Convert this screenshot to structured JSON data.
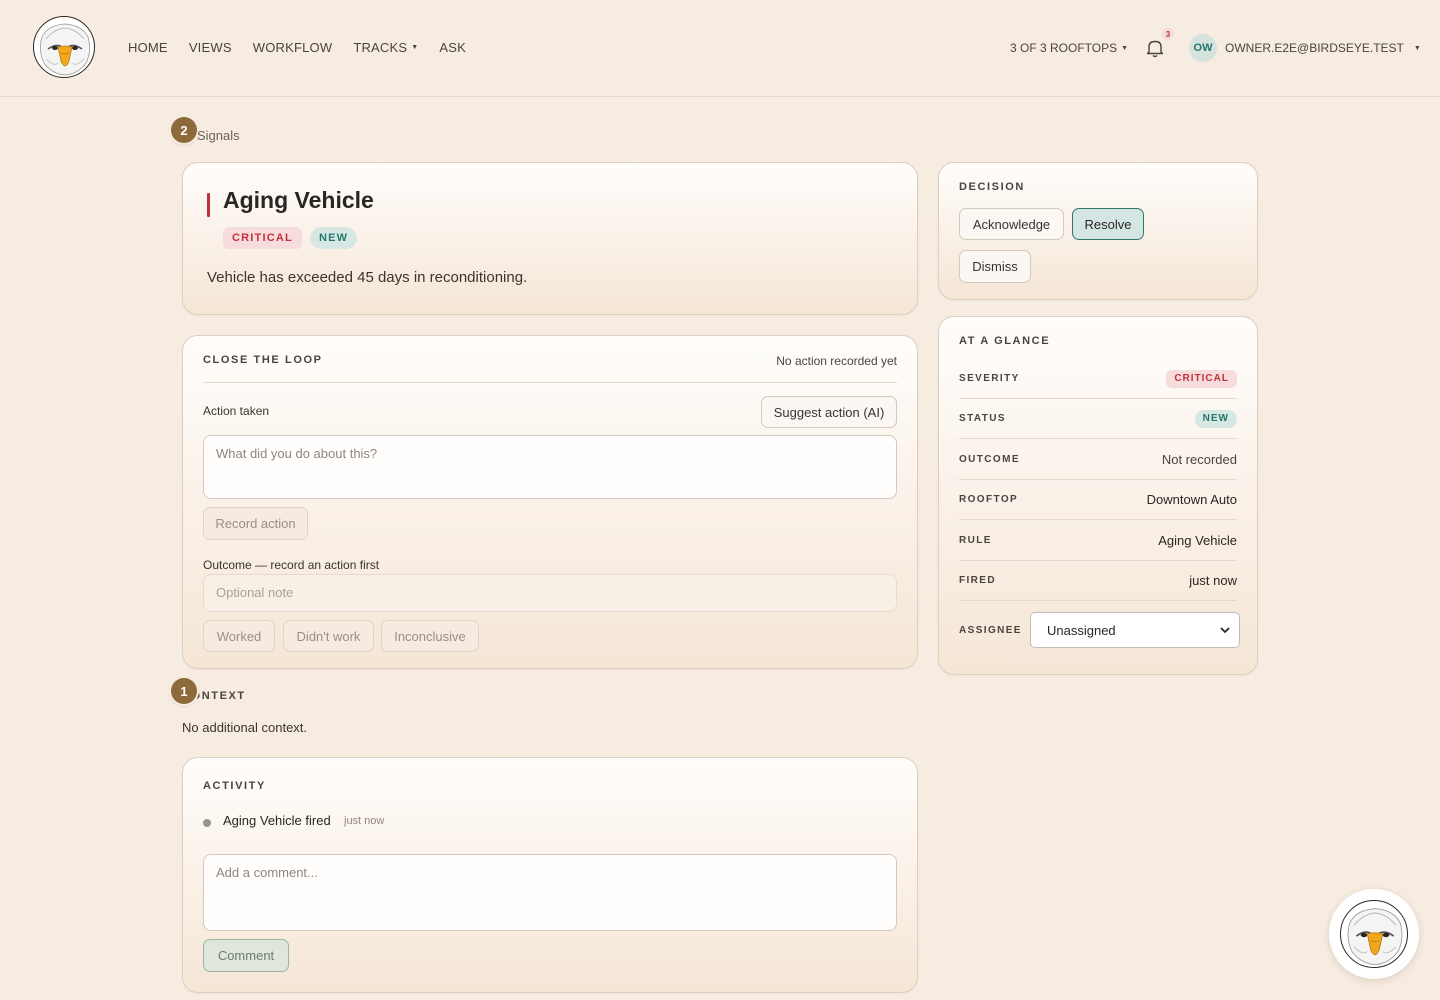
{
  "nav": {
    "items": [
      {
        "label": "HOME"
      },
      {
        "label": "VIEWS"
      },
      {
        "label": "WORKFLOW"
      },
      {
        "label": "TRACKS",
        "has_dropdown": true
      },
      {
        "label": "ASK"
      }
    ],
    "rooftops_label": "3 OF 3 ROOFTOPS",
    "notification_count": "3",
    "avatar_initials": "OW",
    "user_email": "OWNER.E2E@BIRDSEYE.TEST"
  },
  "markers": {
    "first": "2",
    "second": "1"
  },
  "breadcrumb": "Signals",
  "signal": {
    "title": "Aging Vehicle",
    "severity_badge": "CRITICAL",
    "status_badge": "NEW",
    "description": "Vehicle has exceeded 45 days in reconditioning."
  },
  "close_loop": {
    "title": "CLOSE THE LOOP",
    "status": "No action recorded yet",
    "action_label": "Action taken",
    "suggest_button": "Suggest action (AI)",
    "action_placeholder": "What did you do about this?",
    "record_button": "Record action",
    "outcome_label": "Outcome — record an action first",
    "note_placeholder": "Optional note",
    "outcome_buttons": [
      "Worked",
      "Didn't work",
      "Inconclusive"
    ]
  },
  "context": {
    "title": "CONTEXT",
    "text": "No additional context."
  },
  "activity": {
    "title": "ACTIVITY",
    "entries": [
      {
        "text": "Aging Vehicle fired",
        "time": "just now"
      }
    ],
    "comment_placeholder": "Add a comment...",
    "comment_button": "Comment"
  },
  "decision": {
    "title": "DECISION",
    "buttons": {
      "acknowledge": "Acknowledge",
      "resolve": "Resolve",
      "dismiss": "Dismiss"
    }
  },
  "glance": {
    "title": "AT A GLANCE",
    "severity_key": "SEVERITY",
    "severity_val": "CRITICAL",
    "status_key": "STATUS",
    "status_val": "NEW",
    "outcome_key": "OUTCOME",
    "outcome_val": "Not recorded",
    "rooftop_key": "ROOFTOP",
    "rooftop_val": "Downtown Auto",
    "rule_key": "RULE",
    "rule_val": "Aging Vehicle",
    "fired_key": "FIRED",
    "fired_val": "just now",
    "assignee_key": "ASSIGNEE",
    "assignee_val": "Unassigned"
  },
  "colors": {
    "background": "#f7ece1",
    "critical": "#c2323c",
    "critical_bg": "#f6dcdc",
    "new": "#23776b",
    "new_bg": "#d7e8e4",
    "accent_brown": "#8c6a3a",
    "resolve_border": "#31776f"
  },
  "icons": {
    "logo": "eagle-logo-icon",
    "bell": "bell-icon",
    "fab": "eagle-assistant-icon"
  }
}
